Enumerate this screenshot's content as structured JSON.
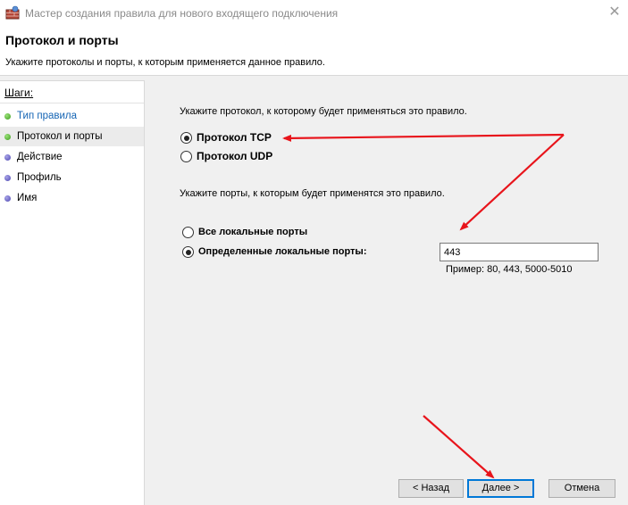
{
  "window": {
    "title": "Мастер создания правила для нового входящего подключения",
    "close_glyph": "✕"
  },
  "header": {
    "title": "Протокол и порты",
    "subtitle": "Укажите протоколы и порты, к которым применяется данное правило."
  },
  "sidebar": {
    "heading": "Шаги:",
    "steps": [
      {
        "label": "Тип правила",
        "status": "done",
        "is_link": true
      },
      {
        "label": "Протокол и порты",
        "status": "done",
        "is_link": false,
        "active": true
      },
      {
        "label": "Действие",
        "status": "pending",
        "is_link": false
      },
      {
        "label": "Профиль",
        "status": "pending",
        "is_link": false
      },
      {
        "label": "Имя",
        "status": "pending",
        "is_link": false
      }
    ]
  },
  "main": {
    "protocol_prompt": "Укажите протокол, к которому будет применяться это правило.",
    "protocol_options": [
      {
        "label": "Протокол TCP",
        "checked": true
      },
      {
        "label": "Протокол UDP",
        "checked": false
      }
    ],
    "ports_prompt": "Укажите порты, к которым будет применятся это правило.",
    "port_options": [
      {
        "label": "Все локальные порты",
        "checked": false
      },
      {
        "label": "Определенные локальные порты:",
        "checked": true
      }
    ],
    "ports_value": "443",
    "ports_example": "Пример: 80, 443, 5000-5010"
  },
  "footer": {
    "back_label": "< Назад",
    "next_label": "Далее >",
    "cancel_label": "Отмена"
  },
  "colors": {
    "accent": "#0078d7",
    "annotation_arrow": "#e8141b",
    "link": "#1464b4"
  }
}
